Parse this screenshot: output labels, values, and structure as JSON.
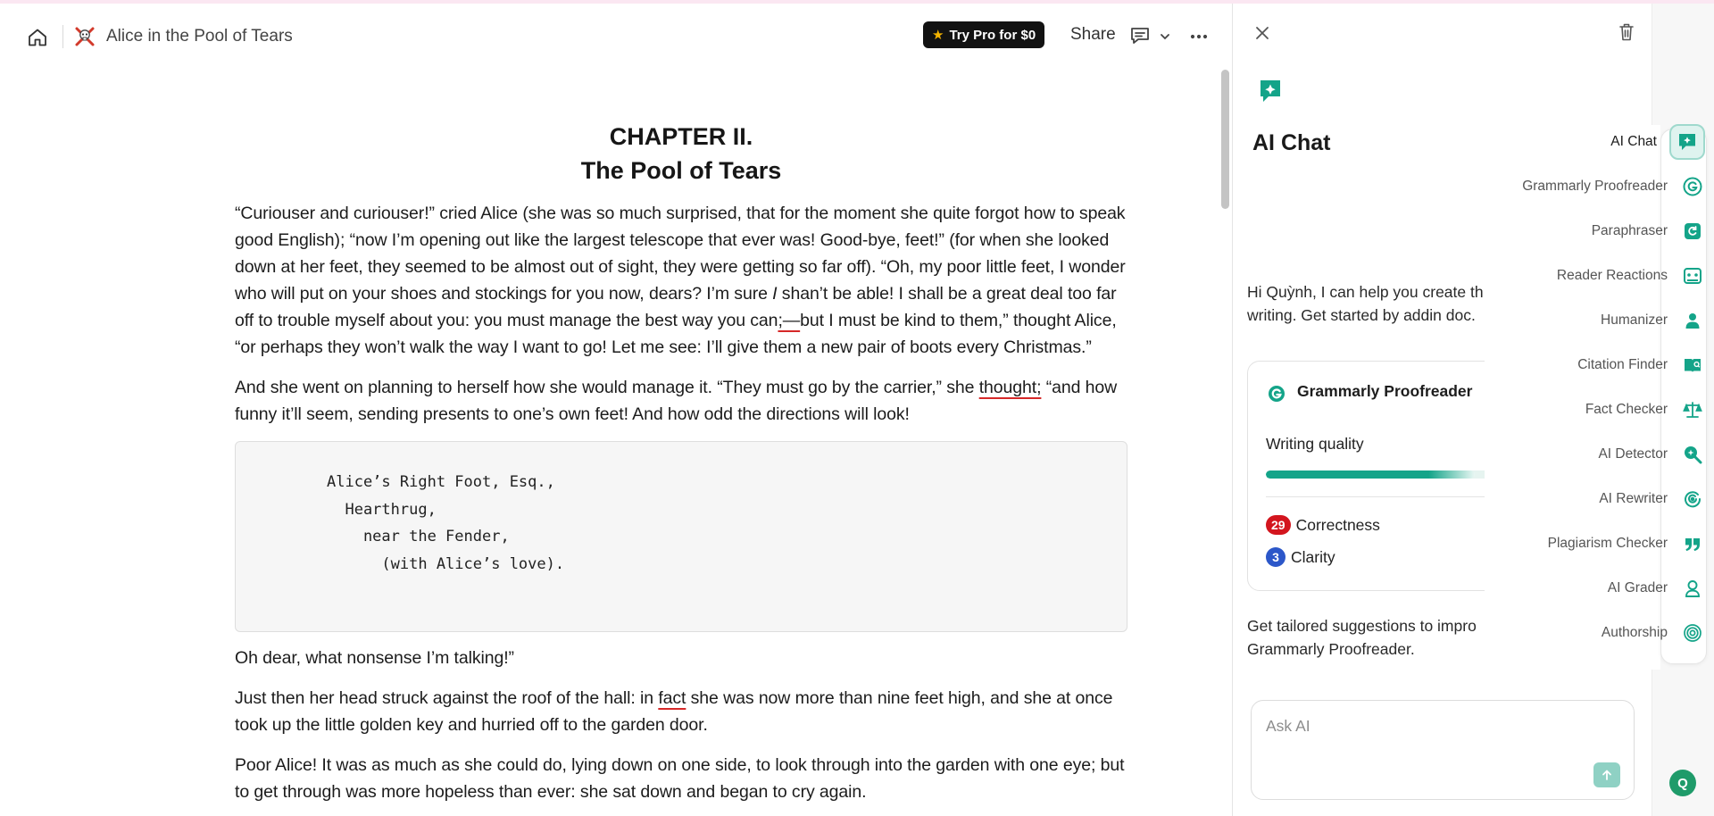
{
  "topbar": {
    "doc_title": "Alice in the Pool of Tears",
    "pro_label": "Try Pro for $0",
    "share_label": "Share"
  },
  "document": {
    "chapter_line1": "CHAPTER II.",
    "chapter_line2": "The Pool of Tears",
    "p1_a": "“Curiouser and curiouser!” cried Alice (she was so much surprised, that for the moment she quite forgot how to speak good English); “now I’m opening out like the largest telescope that ever was! Good-bye, feet!” (for when she looked down at her feet, they seemed to be almost out of sight, they were getting so far off). “Oh, my poor little feet, I wonder who will put on your shoes and stockings for you now, dears? I’m sure ",
    "p1_i": "I",
    "p1_b": " shan’t be able! I shall be a great deal too far off to trouble myself about you: you must manage the best way you can",
    "p1_err": ";—",
    "p1_c": "but I must be kind to them,” thought Alice, “or perhaps they won’t walk the way I want to go! Let me see: I’ll give them a new pair of boots every Christmas.”",
    "p2_a": "And she went on planning to herself how she would manage it. “They must go by the carrier,” she ",
    "p2_err": "thought;",
    "p2_b": " “and how funny it’ll seem, sending presents to one’s own feet! And how odd the directions will look!",
    "code": "Alice’s Right Foot, Esq.,\n  Hearthrug,\n    near the Fender,\n      (with Alice’s love).",
    "p3": "Oh dear, what nonsense I’m talking!”",
    "p4_a": "Just then her head struck against the roof of the hall: in ",
    "p4_err": "fact",
    "p4_b": " she was now more than nine feet high, and she at once took up the little golden key and hurried off to the garden door.",
    "p5": "Poor Alice! It was as much as she could do, lying down on one side, to look through into the garden with one eye; but to get through was more hopeless than ever: she sat down and began to cry again."
  },
  "panel": {
    "title": "AI Chat",
    "intro": "Hi Quỳnh, I can help you create th your writing. Get started by addin doc.",
    "card": {
      "title": "Grammarly Proofreader",
      "quality_label": "Writing quality",
      "quality_fraction": 0.78,
      "correctness_count": "29",
      "correctness_label": "Correctness",
      "clarity_count": "3",
      "clarity_label": "Clarity"
    },
    "tailored": "Get tailored suggestions to impro Grammarly Proofreader.",
    "ask_placeholder": "Ask AI"
  },
  "tools": [
    {
      "label": "AI Chat",
      "icon": "ai-chat-icon"
    },
    {
      "label": "Grammarly Proofreader",
      "icon": "grammarly-icon"
    },
    {
      "label": "Paraphraser",
      "icon": "paraphraser-icon"
    },
    {
      "label": "Reader Reactions",
      "icon": "reader-reactions-icon"
    },
    {
      "label": "Humanizer",
      "icon": "humanizer-icon"
    },
    {
      "label": "Citation Finder",
      "icon": "citation-finder-icon"
    },
    {
      "label": "Fact Checker",
      "icon": "fact-checker-icon"
    },
    {
      "label": "AI Detector",
      "icon": "ai-detector-icon"
    },
    {
      "label": "AI Rewriter",
      "icon": "ai-rewriter-icon"
    },
    {
      "label": "Plagiarism Checker",
      "icon": "plagiarism-checker-icon"
    },
    {
      "label": "AI Grader",
      "icon": "ai-grader-icon"
    },
    {
      "label": "Authorship",
      "icon": "authorship-icon"
    }
  ],
  "user": {
    "avatar_initial": "Q"
  },
  "colors": {
    "accent": "#14a489",
    "error": "#d3151e",
    "clarity": "#2c57c9"
  }
}
